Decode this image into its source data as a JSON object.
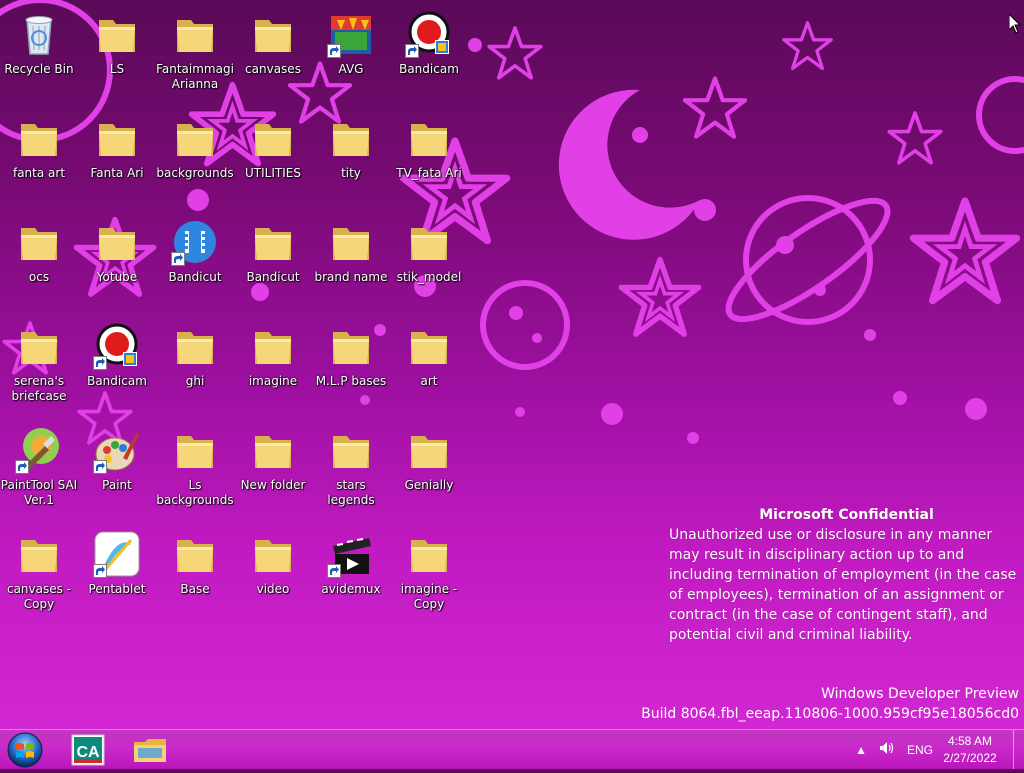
{
  "desktop": {
    "icons": [
      {
        "label": "Recycle Bin",
        "icon": "recycle-bin-icon"
      },
      {
        "label": "LS",
        "icon": "folder-icon"
      },
      {
        "label": "Fantaimmagi Arianna",
        "icon": "folder-icon"
      },
      {
        "label": "canvases",
        "icon": "folder-icon"
      },
      {
        "label": "AVG",
        "icon": "avg-icon"
      },
      {
        "label": "Bandicam",
        "icon": "bandicam-icon"
      },
      {
        "label": "fanta art",
        "icon": "folder-icon"
      },
      {
        "label": "Fanta Ari",
        "icon": "folder-icon"
      },
      {
        "label": "backgrounds",
        "icon": "folder-icon"
      },
      {
        "label": "UTILITIES",
        "icon": "folder-icon"
      },
      {
        "label": "tity",
        "icon": "folder-icon"
      },
      {
        "label": "TV_fata Ari",
        "icon": "folder-icon"
      },
      {
        "label": "ocs",
        "icon": "folder-icon"
      },
      {
        "label": "Yotube",
        "icon": "folder-icon"
      },
      {
        "label": "Bandicut",
        "icon": "bandicut-icon"
      },
      {
        "label": "Bandicut",
        "icon": "folder-icon"
      },
      {
        "label": "brand name",
        "icon": "folder-icon"
      },
      {
        "label": "stik_model",
        "icon": "folder-icon"
      },
      {
        "label": "serena's briefcase",
        "icon": "folder-icon"
      },
      {
        "label": "Bandicam",
        "icon": "bandicam-icon"
      },
      {
        "label": "ghi",
        "icon": "folder-icon"
      },
      {
        "label": "imagine",
        "icon": "folder-icon"
      },
      {
        "label": "M.L.P bases",
        "icon": "folder-icon"
      },
      {
        "label": "art",
        "icon": "folder-icon"
      },
      {
        "label": "PaintTool SAI Ver.1",
        "icon": "painttool-sai-icon"
      },
      {
        "label": "Paint",
        "icon": "paint-icon"
      },
      {
        "label": "Ls backgrounds",
        "icon": "folder-icon"
      },
      {
        "label": "New folder",
        "icon": "folder-icon"
      },
      {
        "label": "stars legends",
        "icon": "folder-icon"
      },
      {
        "label": "Genially",
        "icon": "folder-icon"
      },
      {
        "label": "canvases - Copy",
        "icon": "folder-icon"
      },
      {
        "label": "Pentablet",
        "icon": "pentablet-icon"
      },
      {
        "label": "Base",
        "icon": "folder-icon"
      },
      {
        "label": "video",
        "icon": "folder-icon"
      },
      {
        "label": "avidemux",
        "icon": "avidemux-icon"
      },
      {
        "label": "imagine - Copy",
        "icon": "folder-icon"
      }
    ]
  },
  "notice": {
    "title": "Microsoft Confidential",
    "body": "Unauthorized use or disclosure in any manner may result in disciplinary action up to and including termination of employment (in the case of employees), termination of an assignment or contract (in the case of contingent staff), and potential civil and criminal liability."
  },
  "watermark": {
    "line1": "Windows Developer Preview",
    "line2": "Build 8064.fbl_eeap.110806-1000.959cf95e18056cd0"
  },
  "taskbar": {
    "apps": [
      {
        "icon": "credit-agricole-icon"
      },
      {
        "icon": "file-explorer-icon"
      }
    ],
    "tray": {
      "language": "ENG",
      "time": "4:58 AM",
      "date": "2/27/2022"
    }
  },
  "colors": {
    "folder": "#f5d77a",
    "wallpaper_pattern": "#e040e6"
  }
}
